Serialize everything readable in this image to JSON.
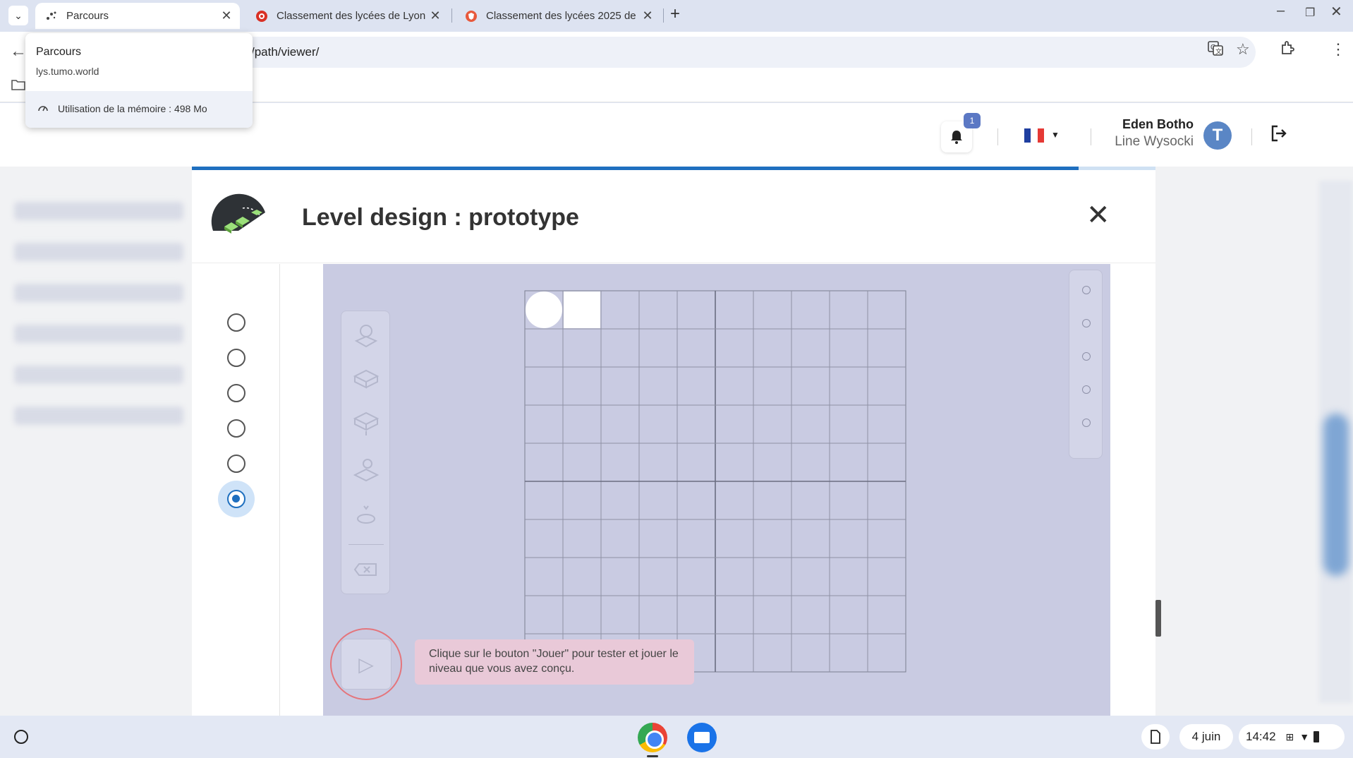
{
  "browser": {
    "tabs": [
      {
        "title": "Parcours",
        "active": true,
        "icon": "tumo-dots-icon"
      },
      {
        "title": "Classement des lycées de Lyon",
        "active": false,
        "icon": "red-at-icon"
      },
      {
        "title": "Classement des lycées 2025 de",
        "active": false,
        "icon": "red-shield-icon"
      }
    ],
    "url": "/path/viewer/"
  },
  "hovercard": {
    "title": "Parcours",
    "url": "lys.tumo.world",
    "memory": "Utilisation de la mémoire : 498 Mo"
  },
  "header": {
    "notification_count": "1",
    "user_name": "Eden Botho",
    "user_subtitle": "Line Wysocki",
    "avatar_letter": "T",
    "language": "fr"
  },
  "modal": {
    "title": "Level design : prototype",
    "progress": 0.92,
    "steps_total": 6,
    "active_step": 6,
    "hint": "Clique sur le bouton \"Jouer\" pour tester et jouer le niveau que vous avez conçu.",
    "grid": {
      "cols": 10,
      "rows": 10
    }
  },
  "shelf": {
    "date": "4 juin",
    "time": "14:42"
  },
  "colors": {
    "accent": "#1f6fbf",
    "editor_bg": "#c9cbe2",
    "hint_bg": "#e9c9d8"
  }
}
